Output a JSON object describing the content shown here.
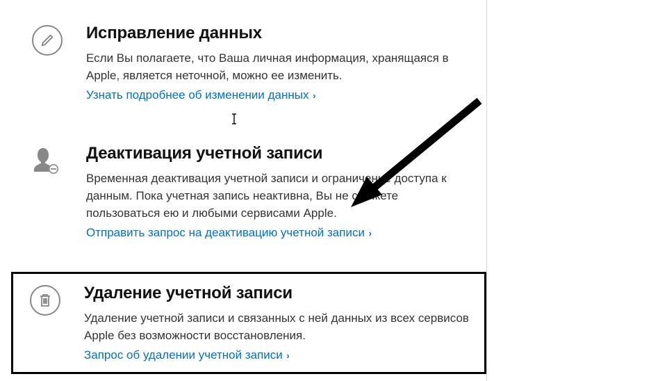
{
  "sections": [
    {
      "title": "Исправление данных",
      "description": "Если Вы полагаете, что Ваша личная информация, хранящаяся в Apple, является неточной, можно ее изменить.",
      "link": "Узнать подробнее об изменении данных"
    },
    {
      "title": "Деактивация учетной записи",
      "description": "Временная деактивация учетной записи и ограничение доступа к данным. Пока учетная запись неактивна, Вы не сможете пользоваться ею и любыми сервисами Apple.",
      "link": "Отправить запрос на деактивацию учетной записи"
    },
    {
      "title": "Удаление учетной записи",
      "description": "Удаление учетной записи и связанных с ней данных из всех сервисов Apple без возможности восстановления.",
      "link": "Запрос об удалении учетной записи"
    }
  ]
}
